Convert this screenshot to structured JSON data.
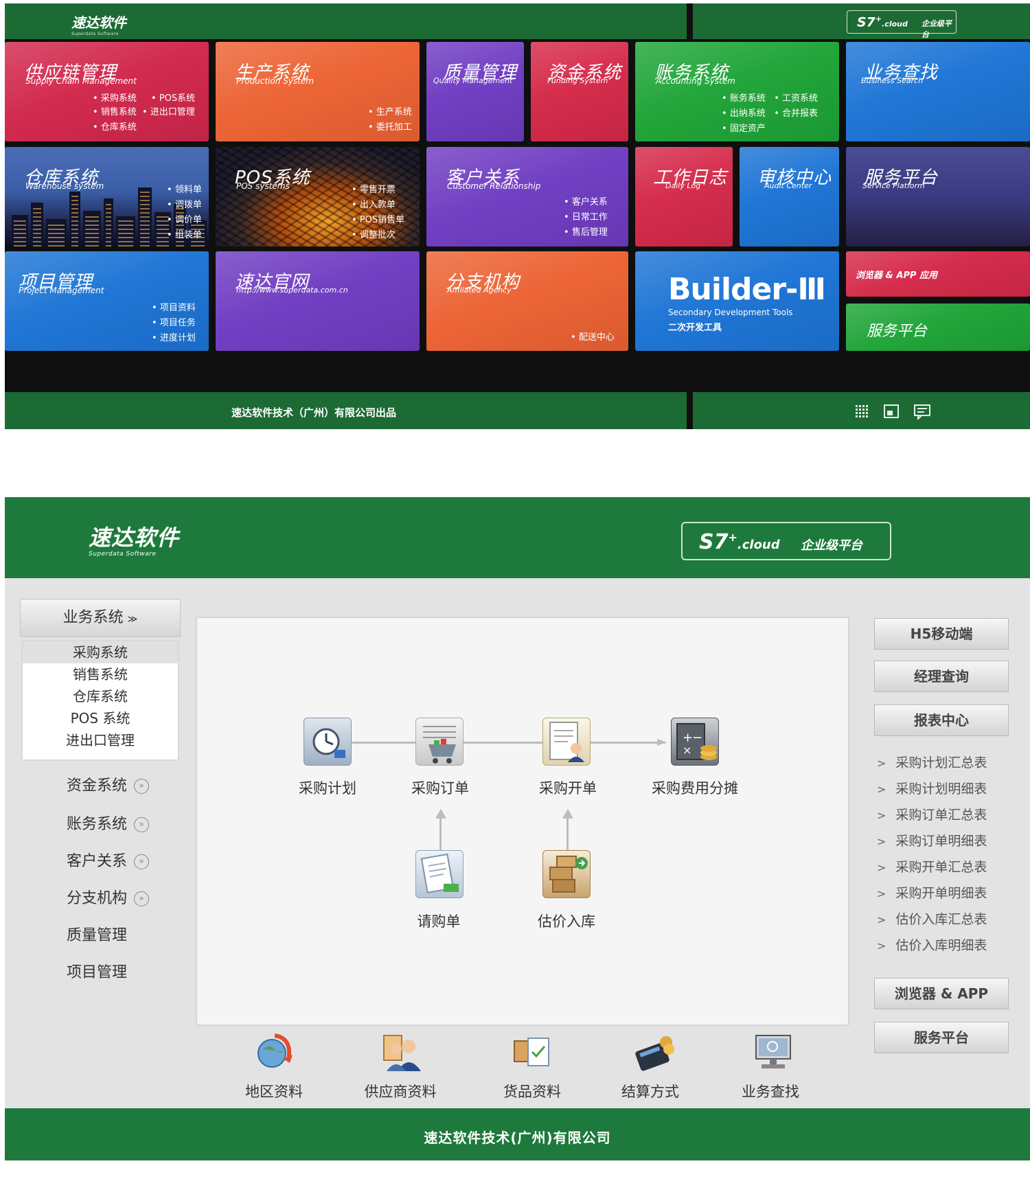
{
  "metro": {
    "logo": "速达软件",
    "logo_sub": "Superdata Software",
    "s7": "S7",
    "s7_sup": "+",
    "s7_cloud": ".cloud",
    "enterprise": "企业级平台",
    "footer": "速达软件技术（广州）有限公司出品",
    "tiles": {
      "supply": {
        "cn": "供应链管理",
        "en": "Supply Chain Management",
        "items": [
          "采购系统",
          "POS系统",
          "销售系统",
          "进出口管理",
          "仓库系统"
        ]
      },
      "production": {
        "cn": "生产系统",
        "en": "Production System",
        "items": [
          "生产系统",
          "委托加工"
        ]
      },
      "quality": {
        "cn": "质量管理",
        "en": "Quality Management"
      },
      "funding": {
        "cn": "资金系统",
        "en": "Funding System"
      },
      "accounting": {
        "cn": "账务系统",
        "en": "Accounting System",
        "items": [
          "账务系统",
          "工资系统",
          "出纳系统",
          "合并报表",
          "固定资产"
        ]
      },
      "search": {
        "cn": "业务查找",
        "en": "Business Search"
      },
      "warehouse": {
        "cn": "仓库系统",
        "en": "Warehouse system",
        "items": [
          "领料单",
          "调拨单",
          "调价单",
          "组装单"
        ]
      },
      "pos": {
        "cn": "POS系统",
        "en": "POS systems",
        "items": [
          "零售开票",
          "出入款单",
          "POS销售单",
          "调整批次"
        ]
      },
      "crm": {
        "cn": "客户关系",
        "en": "Customer Relationship",
        "items": [
          "客户关系",
          "日常工作",
          "售后管理"
        ]
      },
      "worklog": {
        "cn": "工作日志",
        "en": "Daily Log"
      },
      "audit": {
        "cn": "审核中心",
        "en": "Audit Center"
      },
      "service": {
        "cn": "服务平台",
        "en": "Service Platform"
      },
      "project": {
        "cn": "项目管理",
        "en": "Project Management",
        "items": [
          "项目资料",
          "项目任务",
          "进度计划"
        ]
      },
      "website": {
        "cn": "速达官网",
        "en": "http://www.superdata.com.cn"
      },
      "branch": {
        "cn": "分支机构",
        "en": "Affiliated Agency",
        "items": [
          "配送中心"
        ]
      },
      "builder": {
        "title": "Builder-Ⅲ",
        "sub_en": "Secondary Development Tools",
        "sub_cn": "二次开发工具"
      },
      "browser": {
        "label": "浏览器 & APP 应用"
      },
      "service2": {
        "label": "服务平台"
      }
    }
  },
  "app": {
    "logo": "速达软件",
    "logo_sub": "Superdata Software",
    "s7": "S7",
    "s7_sup": "+",
    "s7_cloud": ".cloud",
    "enterprise": "企业级平台",
    "sidebar": {
      "header": "业务系统",
      "expanded": [
        "采购系统",
        "销售系统",
        "仓库系统",
        "POS 系统",
        "进出口管理"
      ],
      "items": [
        "资金系统",
        "账务系统",
        "客户关系",
        "分支机构",
        "质量管理",
        "项目管理"
      ]
    },
    "flow": {
      "plan": "采购计划",
      "order": "采购订单",
      "invoice": "采购开单",
      "cost": "采购费用分摊",
      "request": "请购单",
      "estimate": "估价入库"
    },
    "bottom": [
      "地区资料",
      "供应商资料",
      "货品资料",
      "结算方式",
      "业务查找"
    ],
    "right_buttons": [
      "H5移动端",
      "经理查询",
      "报表中心"
    ],
    "reports": [
      "采购计划汇总表",
      "采购计划明细表",
      "采购订单汇总表",
      "采购订单明细表",
      "采购开单汇总表",
      "采购开单明细表",
      "估价入库汇总表",
      "估价入库明细表"
    ],
    "right_bottom": [
      "浏览器 & APP",
      "服务平台"
    ],
    "footer": "速达软件技术(广州)有限公司"
  }
}
